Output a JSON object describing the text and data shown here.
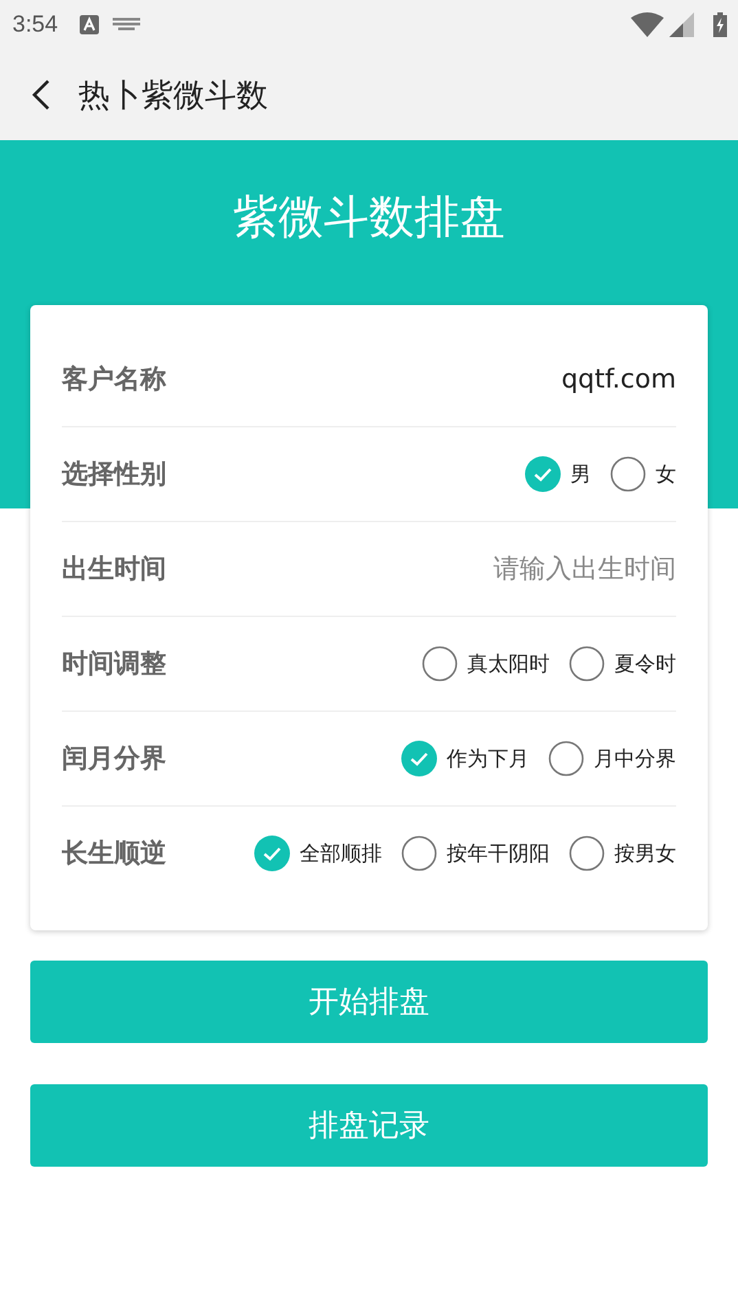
{
  "status_bar": {
    "time": "3:54"
  },
  "app_bar": {
    "title": "热卜紫微斗数"
  },
  "header": {
    "title": "紫微斗数排盘"
  },
  "form": {
    "rows": [
      {
        "kind": "input",
        "label": "客户名称",
        "value": "qqtf.com"
      },
      {
        "kind": "radio",
        "label": "选择性别",
        "options": [
          {
            "label": "男",
            "selected": true
          },
          {
            "label": "女",
            "selected": false
          }
        ]
      },
      {
        "kind": "input",
        "label": "出生时间",
        "placeholder": "请输入出生时间"
      },
      {
        "kind": "radio",
        "label": "时间调整",
        "options": [
          {
            "label": "真太阳时",
            "selected": false
          },
          {
            "label": "夏令时",
            "selected": false
          }
        ]
      },
      {
        "kind": "radio",
        "label": "闰月分界",
        "options": [
          {
            "label": "作为下月",
            "selected": true
          },
          {
            "label": "月中分界",
            "selected": false
          }
        ]
      },
      {
        "kind": "radio",
        "label": "长生顺逆",
        "options": [
          {
            "label": "全部顺排",
            "selected": true
          },
          {
            "label": "按年干阴阳",
            "selected": false
          },
          {
            "label": "按男女",
            "selected": false
          }
        ]
      }
    ]
  },
  "buttons": [
    "开始排盘",
    "排盘记录"
  ]
}
